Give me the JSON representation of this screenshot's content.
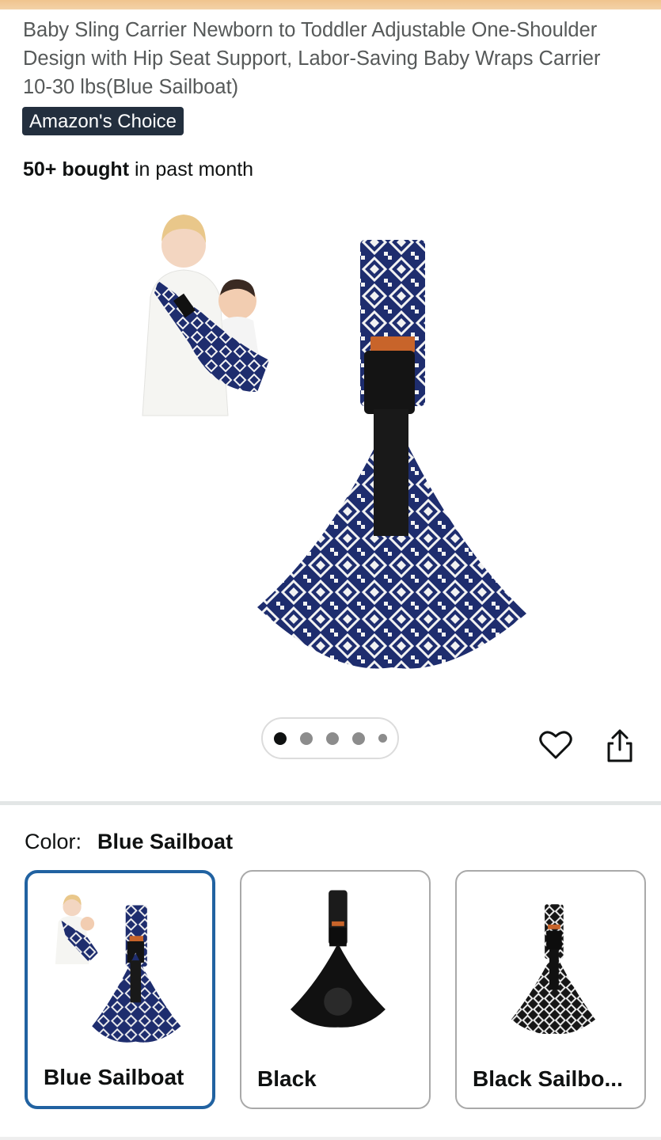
{
  "product": {
    "title": "Baby Sling Carrier Newborn to Toddler Adjustable One-Shoulder Design with Hip Seat Support, Labor-Saving Baby Wraps Carrier 10-30 lbs(Blue Sailboat)",
    "badge": "Amazon's Choice",
    "bought_count": "50+ bought",
    "bought_suffix": " in past month"
  },
  "gallery": {
    "image_count": 5,
    "active_index": 0
  },
  "variants": {
    "label": "Color:",
    "selected": "Blue Sailboat",
    "options": [
      {
        "name": "Blue Sailboat"
      },
      {
        "name": "Black"
      },
      {
        "name": "Black Sailbo..."
      }
    ]
  },
  "colors": {
    "accent": "#2162a1",
    "badge_bg": "#232f3e",
    "navy_fabric": "#1e2d6e"
  }
}
